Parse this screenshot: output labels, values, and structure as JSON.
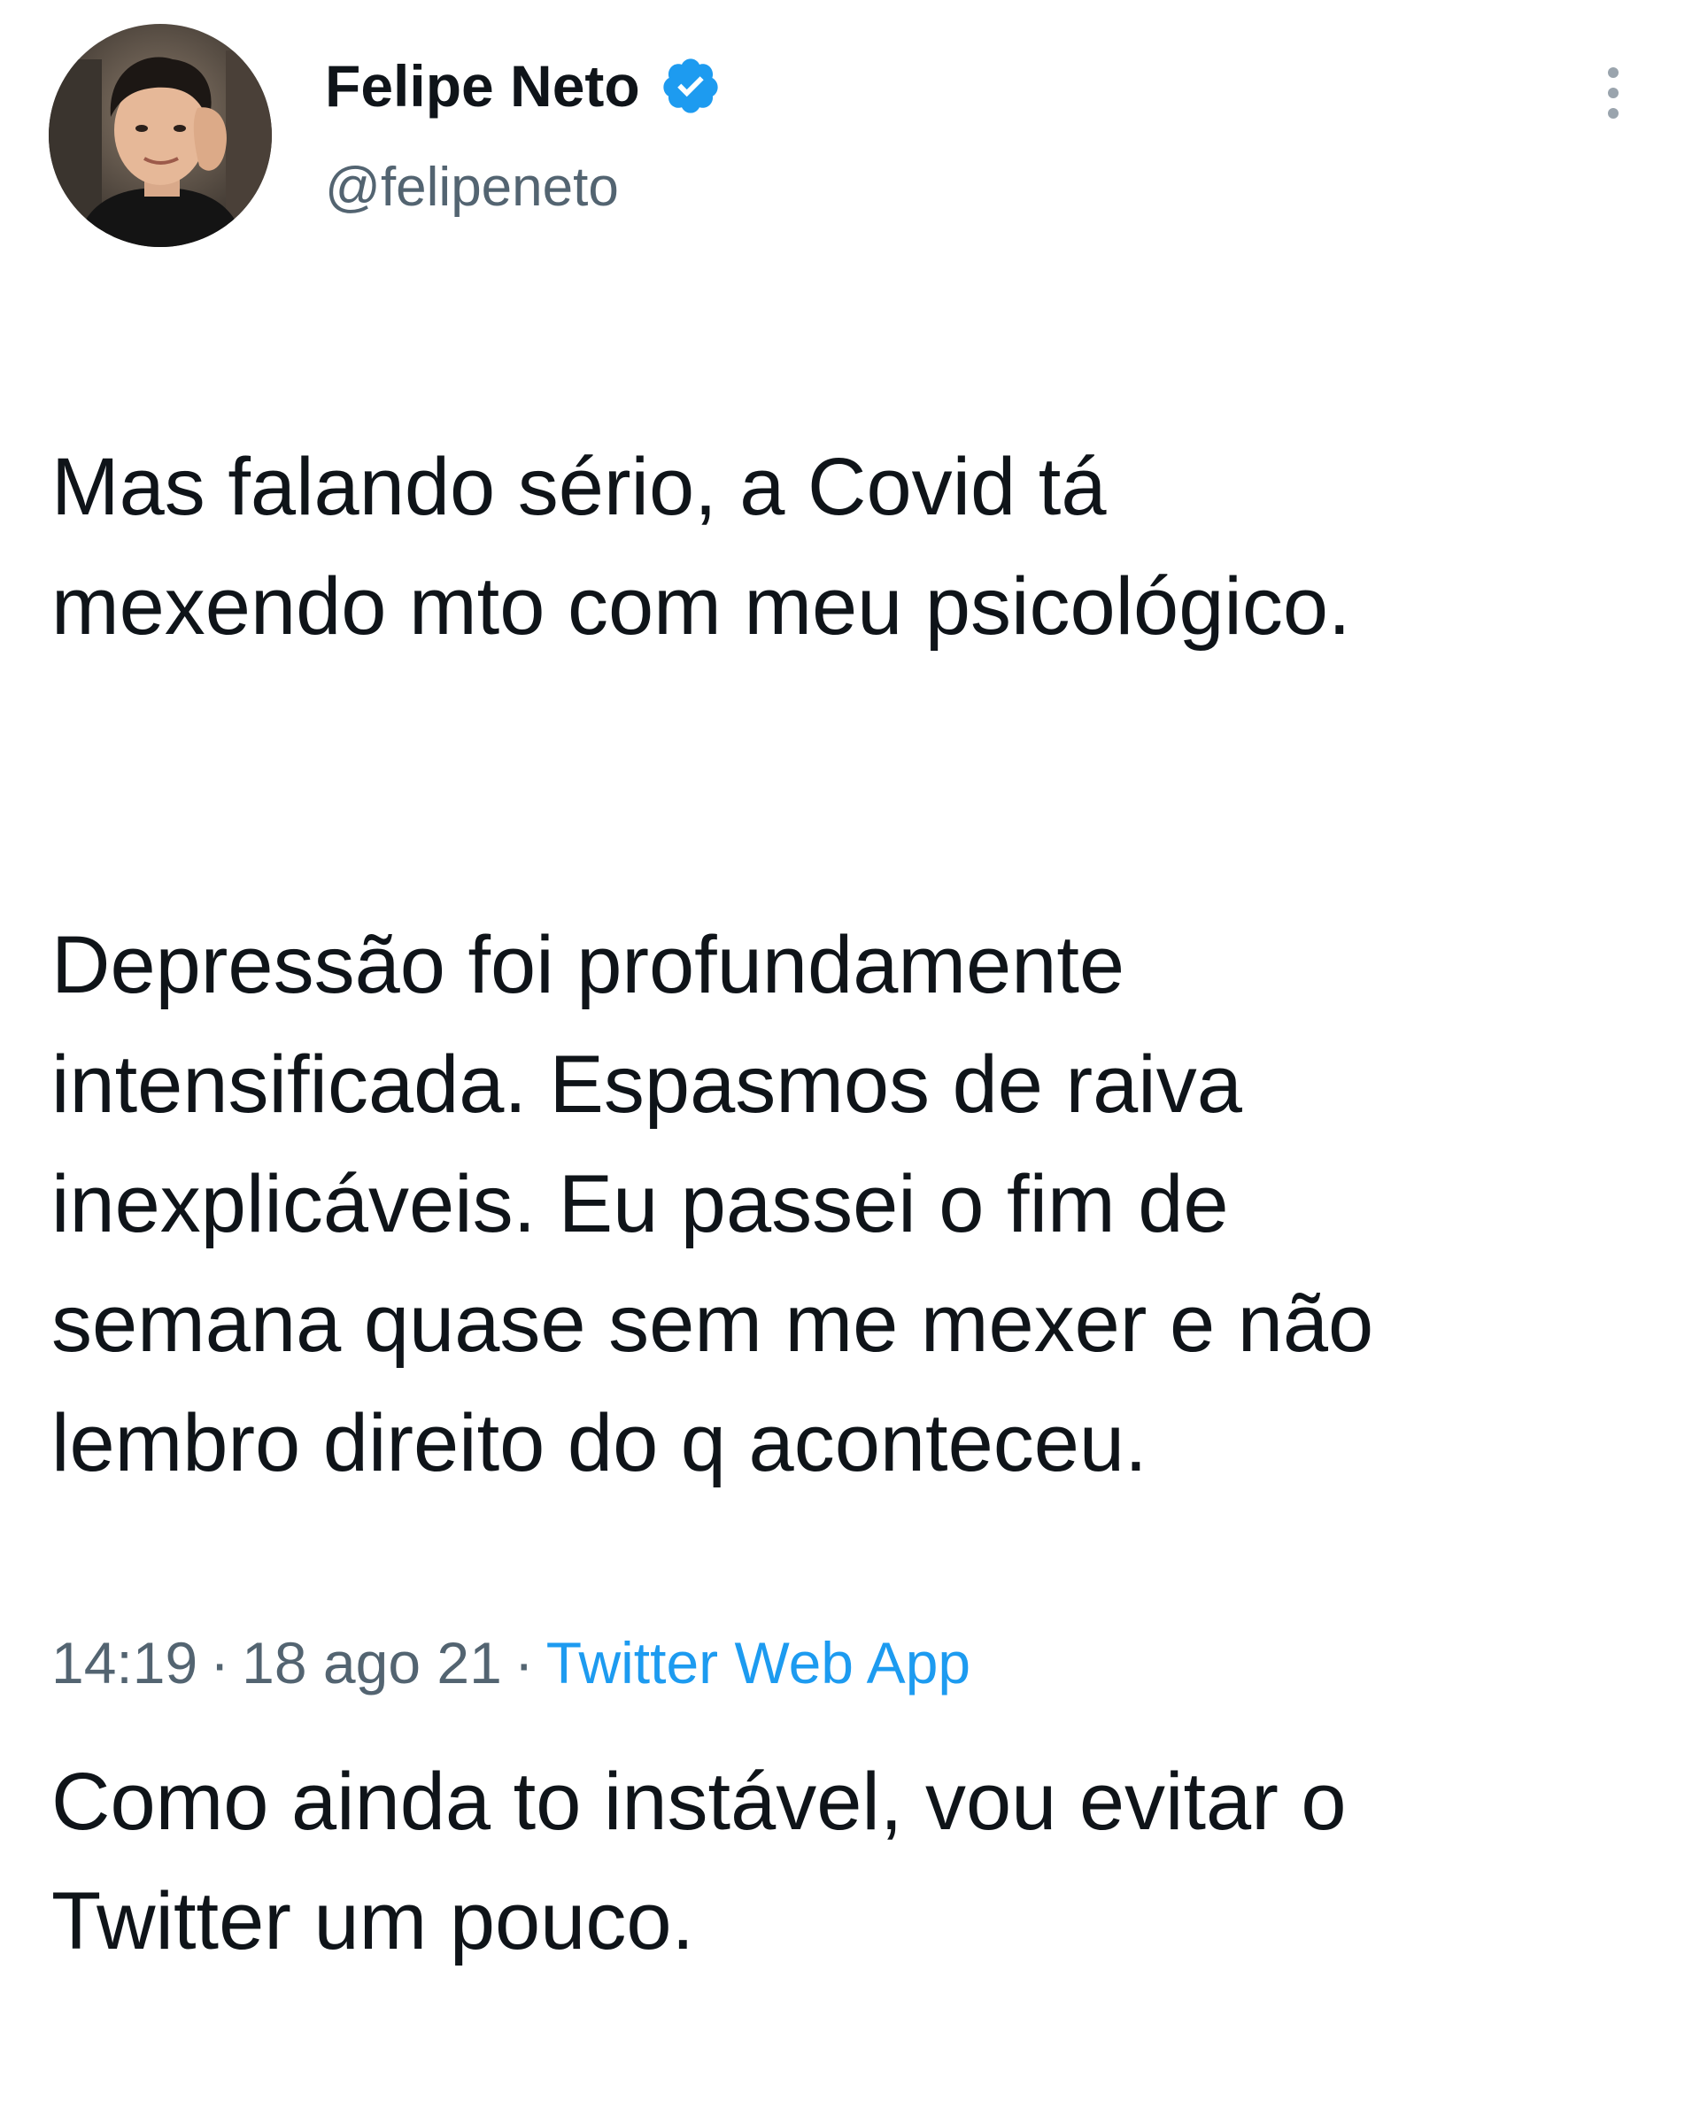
{
  "tweet": {
    "author": {
      "display_name": "Felipe Neto",
      "handle": "@felipeneto",
      "verified_icon": "verified-badge-icon"
    },
    "more_icon": "more-vertical-icon",
    "text": {
      "paragraph_1": "Mas falando sério, a Covid tá\nmexendo mto com meu psicológico.",
      "paragraph_2": "Depressão foi profundamente\nintensificada. Espasmos de raiva\ninexplicáveis. Eu passei o fim de\nsemana quase sem me mexer e não\nlembro direito do q aconteceu.",
      "paragraph_3": "Como ainda to instável, vou evitar o\nTwitter um pouco."
    },
    "meta": {
      "time": "14:19",
      "separator": "·",
      "date": "18 ago 21",
      "source": "Twitter Web App"
    },
    "colors": {
      "text": "#0f1419",
      "secondary": "#536471",
      "link": "#1d9bf0",
      "verified": "#1d9bf0"
    }
  }
}
